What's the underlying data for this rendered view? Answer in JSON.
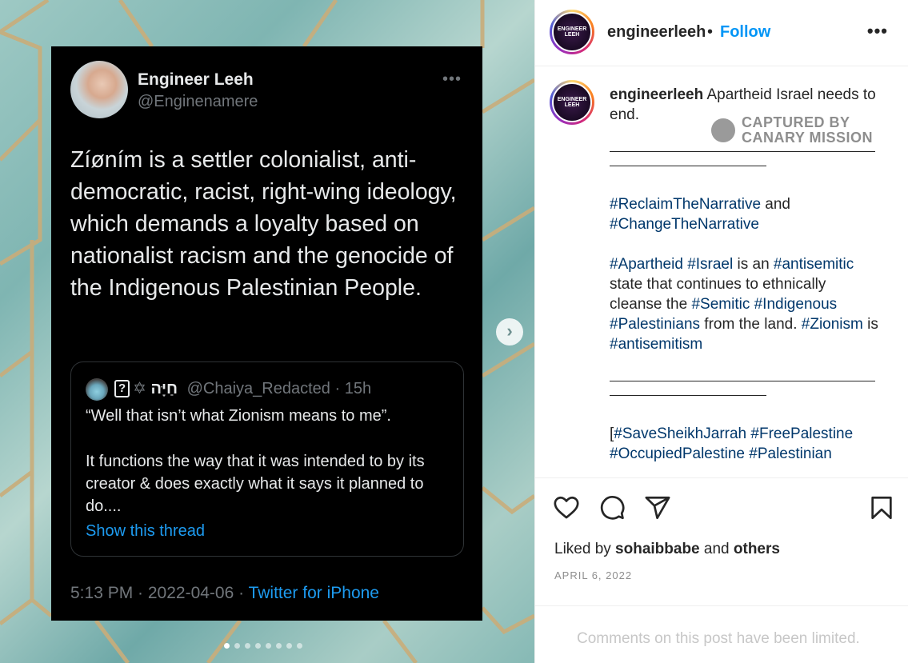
{
  "post": {
    "username": "engineerleeh",
    "separator": "•",
    "follow_label": "Follow",
    "more_icon": "•••",
    "avatar_text": "ENGINEER LEEH"
  },
  "tweet": {
    "name": "Engineer Leeh",
    "handle": "@Enginenamere",
    "more": "•••",
    "body": "Zíøním is a settler colonialist, anti-democratic, racist, right-wing ideology, which demands a loyalty based on nationalist racism and the genocide of the Indigenous Palestinian People.",
    "quote": {
      "badge": "?",
      "star": "✡",
      "hebrew_name": "חַיָּה",
      "handle": "@Chaiya_Redacted",
      "time": "· 15h",
      "line1": "“Well that isn’t what Zionism means to me”.",
      "line2": "It functions the way that it was intended to by its creator & does exactly what it says it planned to do....",
      "link": "Show this thread"
    },
    "footer_time": "5:13 PM · 2022-04-06 · ",
    "footer_source": "Twitter for iPhone"
  },
  "caption": {
    "username": "engineerleeh",
    "text1": "Apartheid Israel needs to end.",
    "tag_reclaim": "#ReclaimTheNarrative",
    "and": " and ",
    "tag_change": "#ChangeTheNarrative",
    "tag_apartheid": "#Apartheid",
    "tag_israel": "#Israel",
    "is_an": " is an ",
    "tag_antisemitic": "#antisemitic",
    "state_text": " state that continues to ethnically cleanse the ",
    "tag_semitic": "#Semitic",
    "tag_indigenous": "#Indigenous",
    "tag_palestinians": "#Palestinians",
    "from_land": " from the land. ",
    "tag_zionism": "#Zionism",
    "is_text": " is ",
    "tag_antisemitism": "#antisemitism",
    "bracket": "[",
    "tag_sheikh": "#SaveSheikhJarrah",
    "tag_freepal": "#FreePalestine",
    "tag_occupied": "#OccupiedPalestine",
    "tag_palestinian": "#Palestinian"
  },
  "watermark": {
    "line1": "CAPTURED BY",
    "line2": "CANARY MISSION"
  },
  "media": {
    "next_glyph": "›",
    "slides": 8,
    "active_slide": 1
  },
  "engagement": {
    "liked_prefix": "Liked by ",
    "liked_user": "sohaibbabe",
    "liked_and": " and ",
    "liked_others": "others",
    "date": "APRIL 6, 2022",
    "comments_limited": "Comments on this post have been limited."
  },
  "colors": {
    "link_blue": "#0095f6",
    "hashtag": "#00376b",
    "twitter_blue": "#1d9bf0"
  }
}
